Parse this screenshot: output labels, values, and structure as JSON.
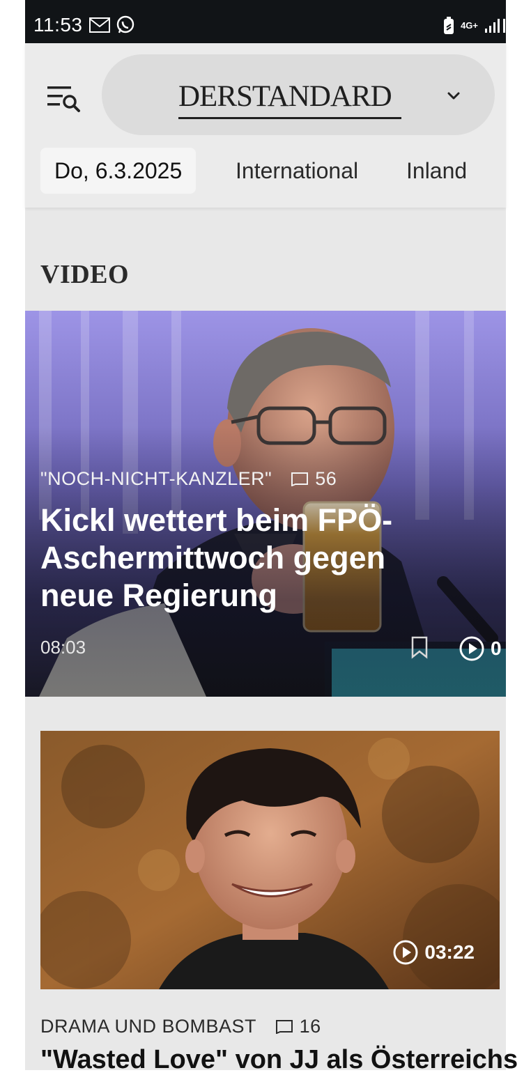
{
  "status_bar": {
    "time": "11:53",
    "left_icons": [
      "mail-icon",
      "whatsapp-icon"
    ],
    "right_icons": [
      "battery-saver-icon",
      "4g-icon",
      "signal-icon"
    ],
    "network_label": "4G+"
  },
  "header": {
    "brand": "DERSTANDARD",
    "menu_icon": "menu-search-icon",
    "dropdown_icon": "chevron-down-icon"
  },
  "nav": {
    "date": "Do, 6.3.2025",
    "items": [
      "International",
      "Inland"
    ]
  },
  "section": {
    "title": "VIDEO"
  },
  "hero": {
    "kicker": "\"NOCH-NICHT-KANZLER\"",
    "comments": "56",
    "title": "Kickl wettert beim FPÖ-Aschermittwoch gegen neue Regierung",
    "time": "08:03",
    "duration_visible": "0"
  },
  "card2": {
    "duration": "03:22",
    "kicker": "DRAMA UND BOMBAST",
    "comments": "16",
    "title": "\"Wasted Love\" von JJ als Österreichs"
  },
  "colors": {
    "page_bg": "#e8e8e8",
    "header_bg": "#ebebeb",
    "pill_bg": "#dcdcdc",
    "status_bg": "#111417"
  }
}
